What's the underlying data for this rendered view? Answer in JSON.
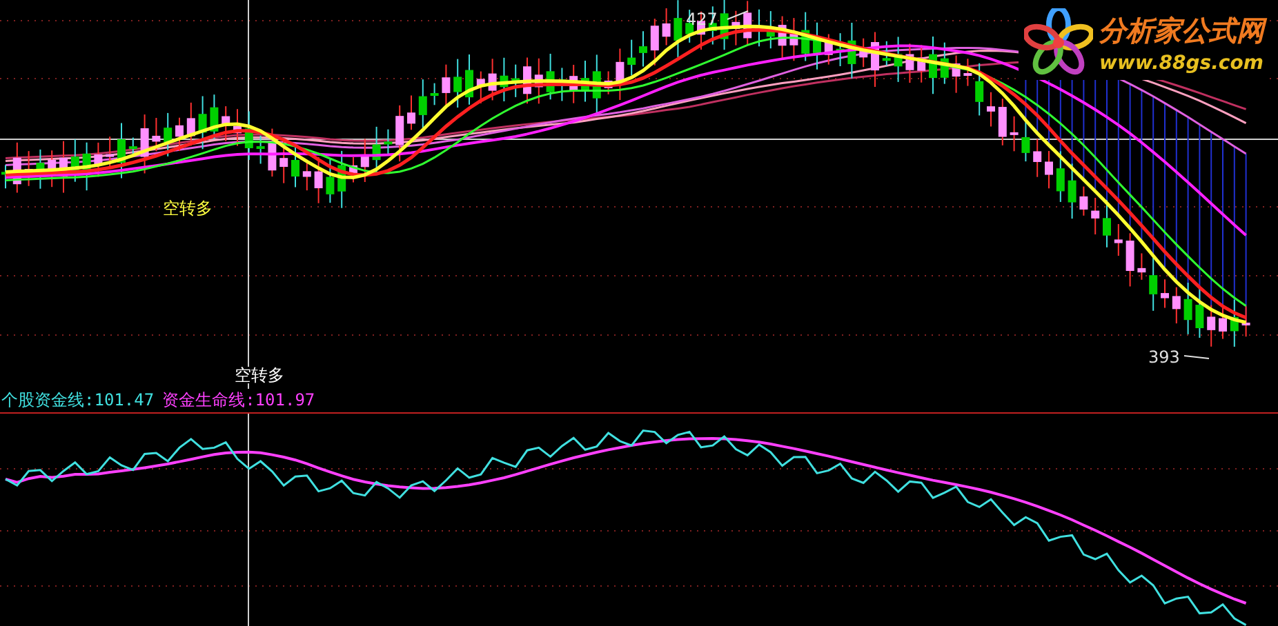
{
  "logo": {
    "name": "分析家公式网",
    "url": "www.88gs.com"
  },
  "price_panel": {
    "high_label": "427",
    "low_label": "393",
    "signals": [
      "空转多",
      "空转多"
    ]
  },
  "indicator_panel": {
    "legend": [
      {
        "label": "个股资金线:101.47",
        "color": "#40e0e0"
      },
      {
        "label": "资金生命线:101.97",
        "color": "#ff40ff"
      }
    ]
  }
}
